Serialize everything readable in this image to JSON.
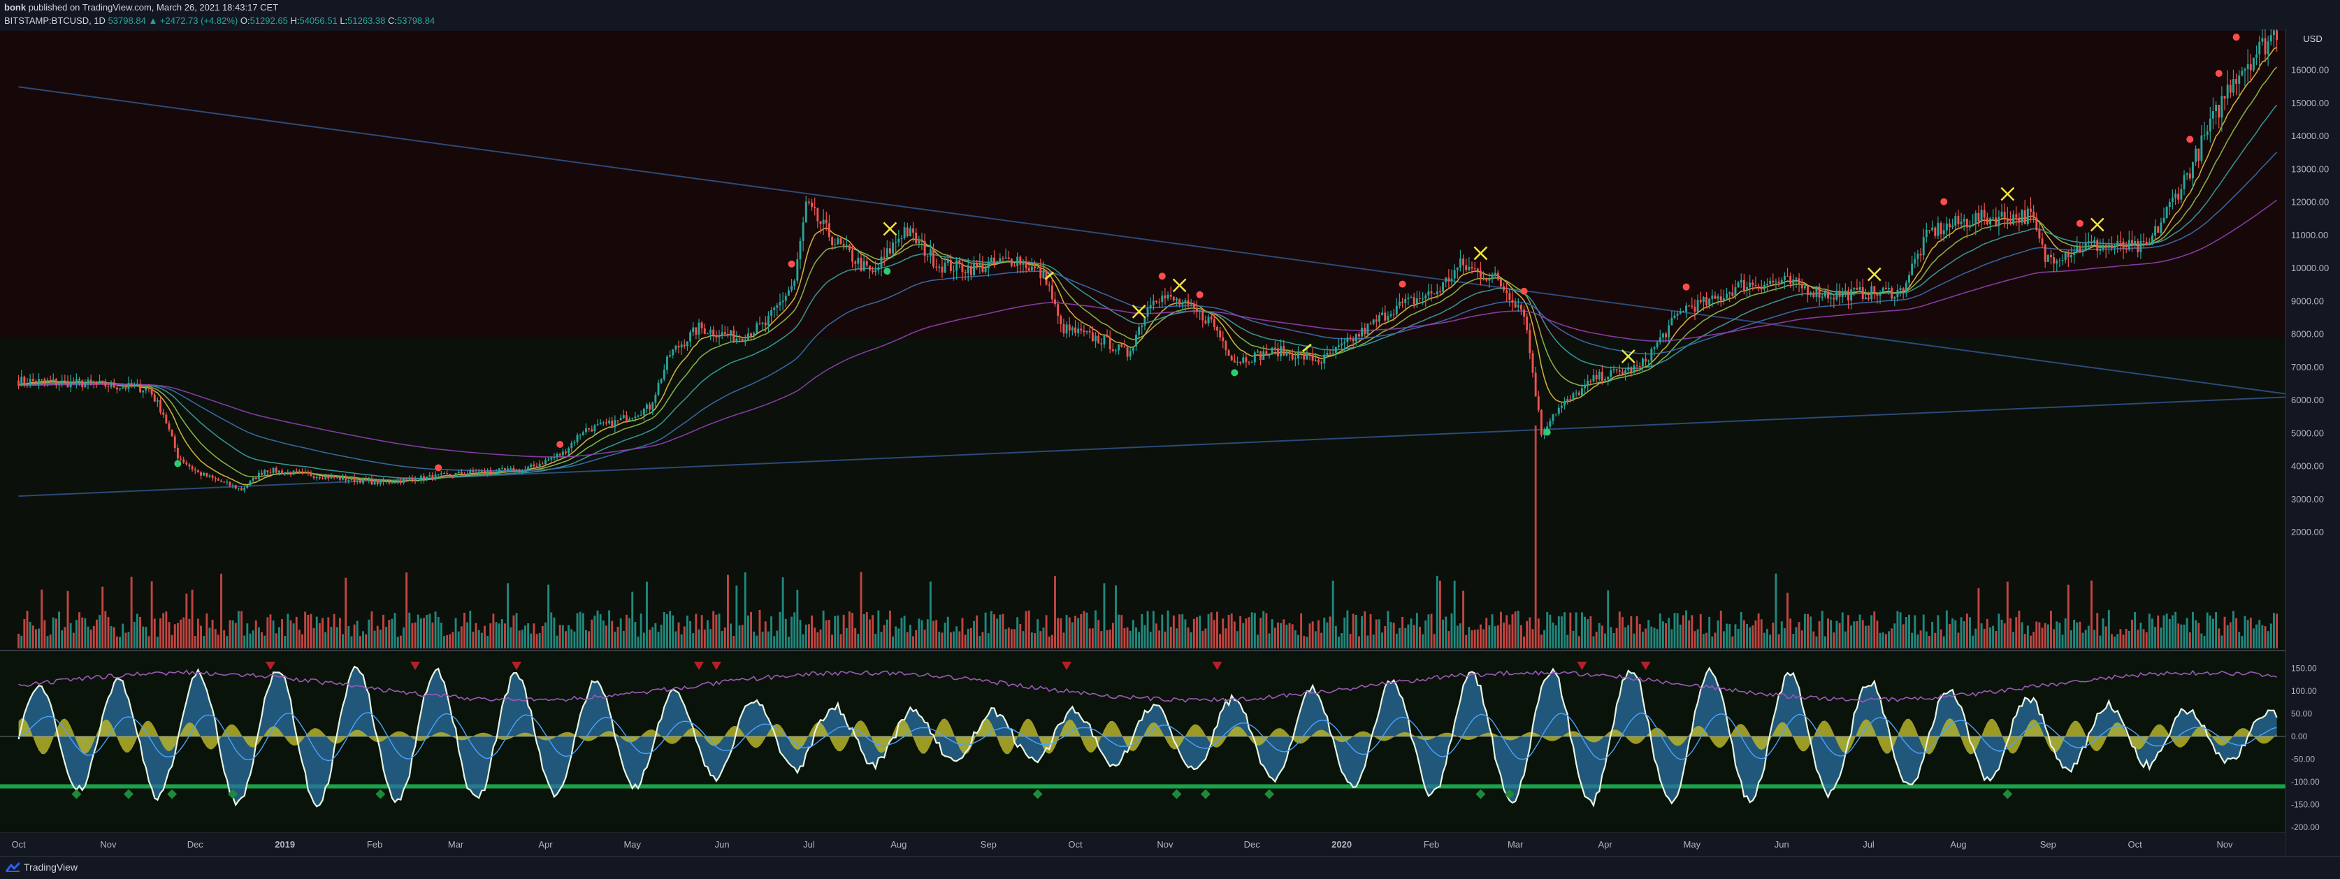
{
  "header": {
    "author": "bonk",
    "published_text": "published on TradingView.com, March 26, 2021 18:43:17 CET",
    "symbol": "BITSTAMP:BTCUSD, 1D",
    "last": "53798.84",
    "change": "▲ +2472.73 (+4.82%)",
    "open_label": "O:",
    "open": "51292.65",
    "high_label": "H:",
    "high": "54056.51",
    "low_label": "L:",
    "low": "51263.38",
    "close_label": "C:",
    "close": "53798.84"
  },
  "footer": {
    "brand": "TradingView",
    "logo_icon": "tradingview-logo-icon"
  },
  "colors": {
    "up": "#26a69a",
    "down": "#ef5350",
    "upper_bg": "#160808",
    "lower_bg": "#0a130a",
    "trendline": "#2b4a78",
    "sig_buy": "#1f8a3a",
    "sig_sell": "#b3202a",
    "cross": "#f0e442",
    "osc_fill": "#2a6fa0",
    "osc_line": "#e8f5e0",
    "yellow_fill": "#b5b32a",
    "brown_fill": "#6e3a2a"
  },
  "chart_data": {
    "type": "candlestick",
    "title": "",
    "price_axis": {
      "currency": "USD",
      "ylim": [
        2000,
        17200
      ],
      "ticks": [
        "16000.00",
        "15000.00",
        "14000.00",
        "13000.00",
        "12000.00",
        "11000.00",
        "10000.00",
        "9000.00",
        "8000.00",
        "7000.00",
        "6000.00",
        "5000.00",
        "4000.00",
        "3000.00",
        "2000.00"
      ]
    },
    "x_axis": {
      "labels": [
        "Oct",
        "Nov",
        "Dec",
        "2019",
        "Feb",
        "Mar",
        "Apr",
        "May",
        "Jun",
        "Jul",
        "Aug",
        "Sep",
        "Oct",
        "Nov",
        "Dec",
        "2020",
        "Feb",
        "Mar",
        "Apr",
        "May",
        "Jun",
        "Jul",
        "Aug",
        "Sep",
        "Oct",
        "Nov"
      ],
      "label_days": [
        0,
        31,
        61,
        92,
        123,
        151,
        182,
        212,
        243,
        273,
        304,
        335,
        365,
        396,
        426,
        457,
        488,
        517,
        548,
        578,
        609,
        639,
        670,
        701,
        731,
        762
      ],
      "range_days": [
        -4,
        783
      ]
    },
    "price_keypoints_day_close": [
      [
        0,
        6600
      ],
      [
        25,
        6500
      ],
      [
        45,
        6350
      ],
      [
        50,
        5600
      ],
      [
        55,
        4300
      ],
      [
        62,
        3800
      ],
      [
        77,
        3300
      ],
      [
        85,
        3900
      ],
      [
        95,
        3800
      ],
      [
        110,
        3650
      ],
      [
        125,
        3500
      ],
      [
        140,
        3650
      ],
      [
        155,
        3800
      ],
      [
        175,
        3900
      ],
      [
        188,
        4400
      ],
      [
        195,
        5100
      ],
      [
        205,
        5300
      ],
      [
        218,
        5800
      ],
      [
        225,
        7400
      ],
      [
        235,
        8200
      ],
      [
        248,
        7900
      ],
      [
        258,
        8300
      ],
      [
        268,
        9600
      ],
      [
        272,
        11900
      ],
      [
        282,
        10800
      ],
      [
        295,
        9800
      ],
      [
        306,
        11200
      ],
      [
        318,
        10100
      ],
      [
        330,
        10000
      ],
      [
        345,
        10300
      ],
      [
        355,
        9700
      ],
      [
        360,
        8200
      ],
      [
        375,
        7800
      ],
      [
        383,
        7400
      ],
      [
        392,
        9200
      ],
      [
        400,
        9000
      ],
      [
        412,
        8400
      ],
      [
        420,
        7200
      ],
      [
        435,
        7500
      ],
      [
        450,
        7200
      ],
      [
        460,
        7800
      ],
      [
        475,
        8800
      ],
      [
        490,
        9300
      ],
      [
        498,
        10100
      ],
      [
        510,
        9700
      ],
      [
        520,
        8700
      ],
      [
        526,
        5000
      ],
      [
        530,
        5600
      ],
      [
        545,
        6700
      ],
      [
        560,
        7000
      ],
      [
        575,
        8800
      ],
      [
        585,
        9000
      ],
      [
        595,
        9500
      ],
      [
        610,
        9600
      ],
      [
        625,
        9200
      ],
      [
        650,
        9300
      ],
      [
        660,
        11100
      ],
      [
        675,
        11500
      ],
      [
        695,
        11600
      ],
      [
        700,
        10300
      ],
      [
        715,
        10700
      ],
      [
        735,
        10600
      ],
      [
        750,
        13000
      ],
      [
        765,
        15800
      ],
      [
        780,
        17200
      ]
    ],
    "ema_periods": [
      10,
      20,
      40,
      80,
      160
    ],
    "trendlines": [
      {
        "name": "descending",
        "from": [
          0,
          15500
        ],
        "to": [
          783,
          6200
        ]
      },
      {
        "name": "ascending",
        "from": [
          0,
          3100
        ],
        "to": [
          783,
          6100
        ]
      }
    ],
    "signals": {
      "sell_dots_days": [
        145,
        187,
        267,
        395,
        408,
        478,
        520,
        576,
        665,
        712,
        750,
        760,
        766
      ],
      "buy_dots_days": [
        55,
        300,
        420,
        528
      ],
      "cross_days": [
        301,
        387,
        401,
        505,
        556,
        641,
        687,
        718
      ],
      "arrow_days": [
        356,
        445
      ]
    },
    "volume_note": "daily volume bars coloured by candle direction",
    "oscillator": {
      "ylim": [
        -200,
        175
      ],
      "ticks": [
        "150.00",
        "100.00",
        "50.00",
        "0.00",
        "-50.00",
        "-100.00",
        "-150.00",
        "-200.00"
      ],
      "cycle_period_days": 27.5,
      "down_arrow_days": [
        87,
        137,
        172,
        235,
        241,
        362,
        414,
        540,
        562
      ],
      "up_diamond_days": [
        20,
        38,
        53,
        74,
        125,
        352,
        400,
        410,
        432,
        505,
        515,
        687
      ]
    }
  }
}
